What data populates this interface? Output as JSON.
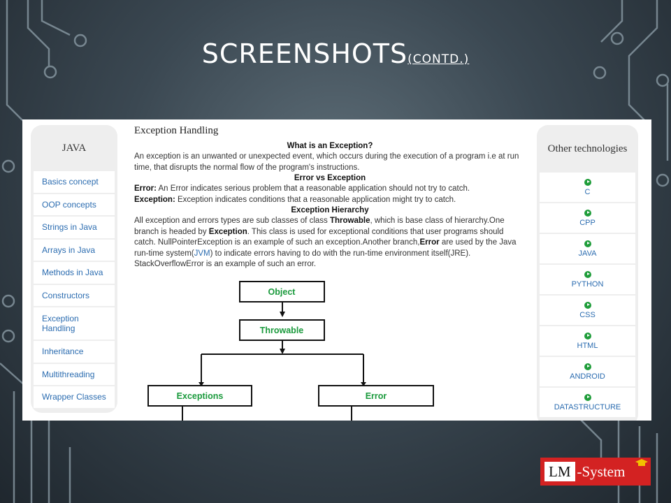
{
  "slide": {
    "title_main": "SCREENSHOTS",
    "title_sub": "(CONTD.)"
  },
  "left_nav": {
    "header": "JAVA",
    "items": [
      "Basics concept",
      "OOP concepts",
      "Strings in Java",
      "Arrays in Java",
      "Methods in Java",
      "Constructors",
      "Exception Handling",
      "Inheritance",
      "Multithreading",
      "Wrapper Classes"
    ]
  },
  "content": {
    "page_title": "Exception Handling",
    "h_what": "What is an Exception?",
    "p_what": "An exception is an unwanted or unexpected event, which occurs during the execution of a program i.e at run time, that disrupts the normal flow of the program's instructions.",
    "h_vs": "Error vs Exception",
    "error_label": "Error:",
    "error_text": " An Error indicates serious problem that a reasonable application should not try to catch.",
    "exception_label": "Exception:",
    "exception_text": " Exception indicates conditions that a reasonable application might try to catch.",
    "h_hier": "Exception Hierarchy",
    "hier_1": "All exception and errors types are sub classes of class ",
    "hier_throwable": "Throwable",
    "hier_2": ", which is base class of hierarchy.One branch is headed by ",
    "hier_exception": "Exception",
    "hier_3": ". This class is used for exceptional conditions that user programs should catch. NullPointerException is an example of such an exception.Another branch,",
    "hier_error": "Error",
    "hier_4": " are used by the Java run-time system(",
    "hier_jvm": "JVM",
    "hier_5": ") to indicate errors having to do with the run-time environment itself(JRE). StackOverflowError is an example of such an error."
  },
  "diagram": {
    "nodes": [
      "Object",
      "Throwable",
      "Exceptions",
      "Error"
    ],
    "node_color": "#1a9a3c"
  },
  "right_nav": {
    "header": "Other technologies",
    "items": [
      "C",
      "CPP",
      "JAVA",
      "PYTHON",
      "CSS",
      "HTML",
      "ANDROID",
      "DATASTRUCTURE"
    ]
  },
  "logo": {
    "lm": "LM",
    "system": "-System",
    "brand_color": "#d32222"
  }
}
